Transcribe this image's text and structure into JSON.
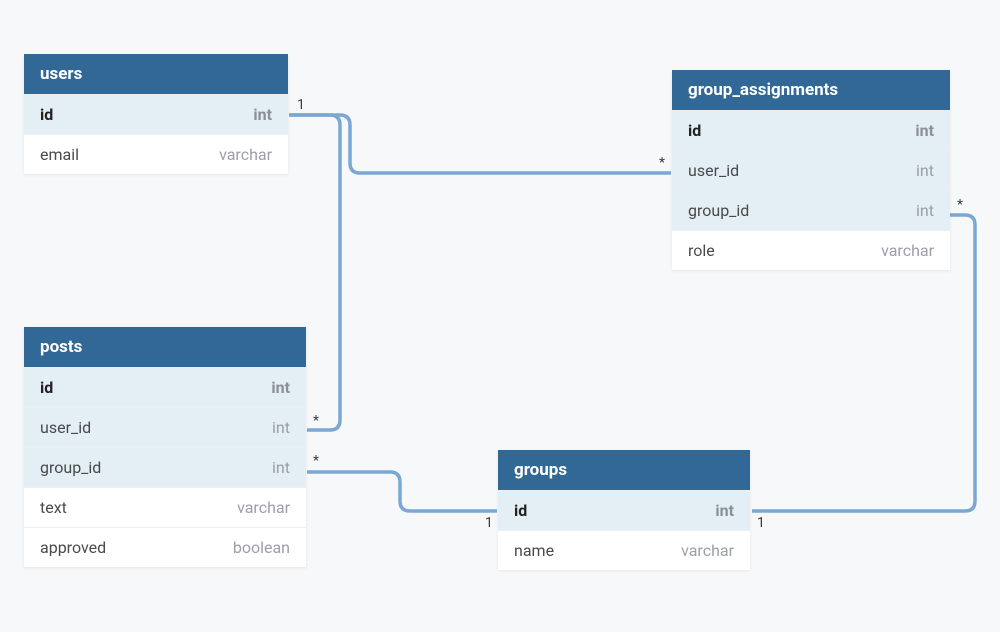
{
  "tables": {
    "users": {
      "name": "users",
      "columns": [
        {
          "name": "id",
          "type": "int",
          "pk": true
        },
        {
          "name": "email",
          "type": "varchar"
        }
      ]
    },
    "group_assignments": {
      "name": "group_assignments",
      "columns": [
        {
          "name": "id",
          "type": "int",
          "pk": true
        },
        {
          "name": "user_id",
          "type": "int",
          "fk": true
        },
        {
          "name": "group_id",
          "type": "int",
          "fk": true
        },
        {
          "name": "role",
          "type": "varchar"
        }
      ]
    },
    "posts": {
      "name": "posts",
      "columns": [
        {
          "name": "id",
          "type": "int",
          "pk": true
        },
        {
          "name": "user_id",
          "type": "int",
          "fk": true
        },
        {
          "name": "group_id",
          "type": "int",
          "fk": true
        },
        {
          "name": "text",
          "type": "varchar"
        },
        {
          "name": "approved",
          "type": "boolean"
        }
      ]
    },
    "groups": {
      "name": "groups",
      "columns": [
        {
          "name": "id",
          "type": "int",
          "pk": true
        },
        {
          "name": "name",
          "type": "varchar"
        }
      ]
    }
  },
  "relationships": [
    {
      "from": "users.id",
      "to": "group_assignments.user_id",
      "from_card": "1",
      "to_card": "*"
    },
    {
      "from": "users.id",
      "to": "posts.user_id",
      "from_card": "1",
      "to_card": "*"
    },
    {
      "from": "groups.id",
      "to": "posts.group_id",
      "from_card": "1",
      "to_card": "*"
    },
    {
      "from": "groups.id",
      "to": "group_assignments.group_id",
      "from_card": "1",
      "to_card": "*"
    }
  ],
  "labels": {
    "one": "1",
    "many": "*"
  },
  "colors": {
    "header_bg": "#316896",
    "pk_bg": "#e3eef5",
    "connector": "#7aa8d4"
  }
}
